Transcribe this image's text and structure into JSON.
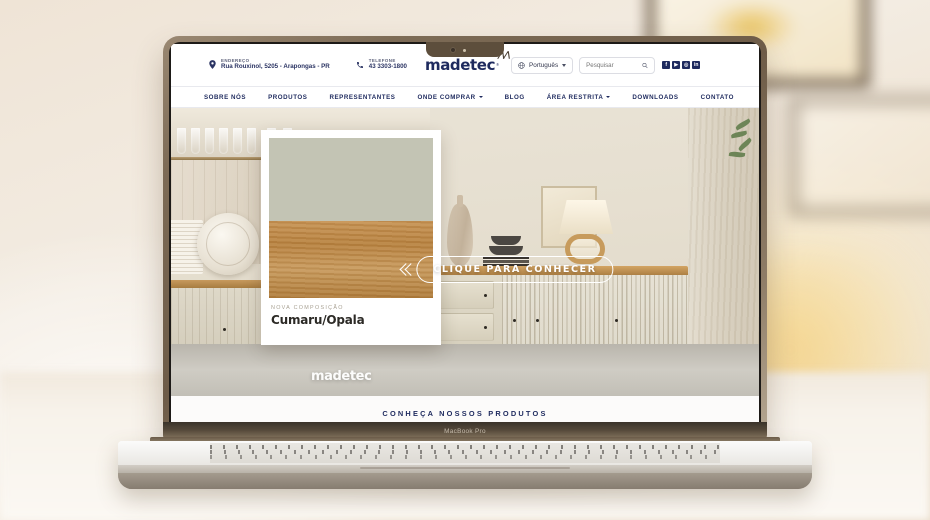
{
  "device": {
    "label": "MacBook Pro"
  },
  "site": {
    "topbar": {
      "address": {
        "icon": "map-pin-icon",
        "label": "ENDEREÇO",
        "value": "Rua Rouxinol, 5205 - Arapongas - PR"
      },
      "phone": {
        "icon": "phone-icon",
        "label": "TELEFONE",
        "value": "43 3303-1800"
      },
      "logo": {
        "text": "madetec",
        "registered": "®"
      },
      "language": {
        "icon": "globe-icon",
        "value": "Português",
        "caret": "chevron-down-icon"
      },
      "search": {
        "placeholder": "Pesquisar",
        "icon": "search-icon"
      },
      "social": [
        {
          "name": "facebook-icon",
          "glyph": "f"
        },
        {
          "name": "youtube-icon",
          "glyph": "▶"
        },
        {
          "name": "instagram-icon",
          "glyph": "◎"
        },
        {
          "name": "linkedin-icon",
          "glyph": "in"
        }
      ]
    },
    "nav": [
      {
        "label": "SOBRE NÓS",
        "has_dropdown": false
      },
      {
        "label": "PRODUTOS",
        "has_dropdown": false
      },
      {
        "label": "REPRESENTANTES",
        "has_dropdown": false
      },
      {
        "label": "ONDE COMPRAR",
        "has_dropdown": true
      },
      {
        "label": "BLOG",
        "has_dropdown": false
      },
      {
        "label": "ÁREA RESTRITA",
        "has_dropdown": true
      },
      {
        "label": "DOWNLOADS",
        "has_dropdown": false
      },
      {
        "label": "CONTATO",
        "has_dropdown": false
      }
    ],
    "hero": {
      "card": {
        "eyebrow": "NOVA COMPOSIÇÃO",
        "title": "Cumaru/Opala",
        "swatch_top_color": "#c3c4b4",
        "swatch_bottom_color": "#b8823f"
      },
      "cta": {
        "label": "CLIQUE PARA CONHECER",
        "prev_icon": "chevron-left-icon"
      },
      "watermark": "madetec"
    },
    "bottom_bar": {
      "text": "CONHEÇA NOSSOS PRODUTOS"
    },
    "colors": {
      "brand_navy": "#1e2a5e",
      "muted_text": "#5b6079",
      "card_eyebrow": "#a8a193"
    }
  }
}
